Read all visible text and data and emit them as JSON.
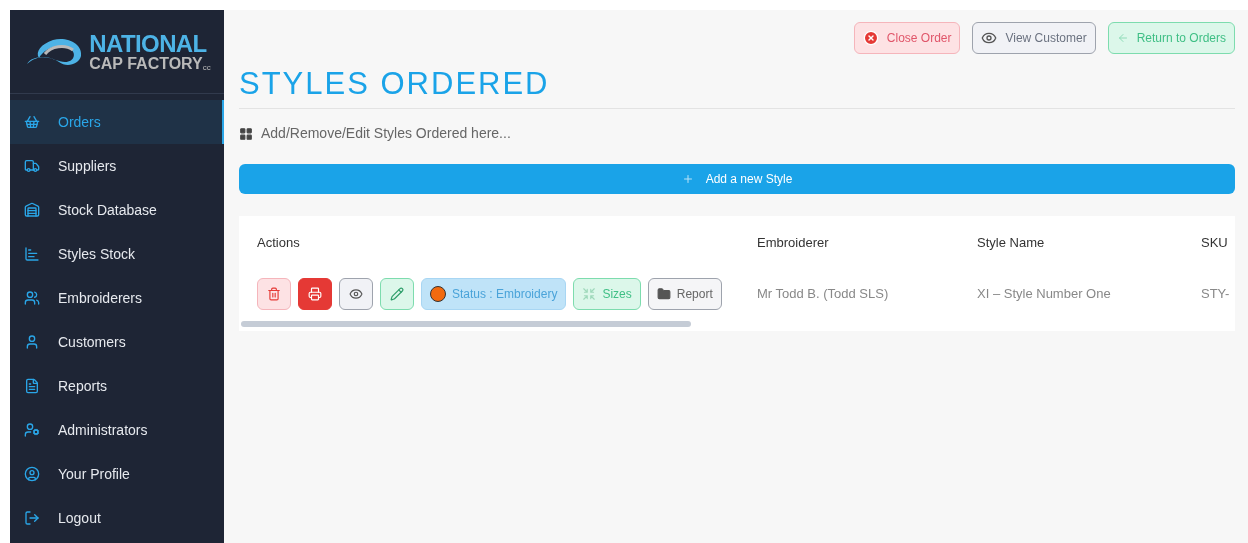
{
  "logo": {
    "line1": "NATIONAL",
    "line2": "CAP FACTORY",
    "mark": "cc"
  },
  "sidebar": {
    "items": [
      {
        "label": "Orders",
        "selected": true
      },
      {
        "label": "Suppliers",
        "selected": false
      },
      {
        "label": "Stock Database",
        "selected": false
      },
      {
        "label": "Styles Stock",
        "selected": false
      },
      {
        "label": "Embroiderers",
        "selected": false
      },
      {
        "label": "Customers",
        "selected": false
      },
      {
        "label": "Reports",
        "selected": false
      },
      {
        "label": "Administrators",
        "selected": false
      },
      {
        "label": "Your Profile",
        "selected": false
      },
      {
        "label": "Logout",
        "selected": false
      }
    ]
  },
  "header_buttons": [
    {
      "label": "Close Order",
      "kind": "danger"
    },
    {
      "label": "View Customer",
      "kind": "neutral"
    },
    {
      "label": "Return to Orders",
      "kind": "success"
    }
  ],
  "title": "STYLES ORDERED",
  "subtitle": "Add/Remove/Edit Styles Ordered here...",
  "add_button": {
    "label": "Add a new Style"
  },
  "table": {
    "columns": [
      "Actions",
      "Embroiderer",
      "Style Name",
      "SKU"
    ],
    "rows": [
      {
        "cells": [
          {
            "kind": "actions",
            "actions": [
              {
                "kind": "delete"
              },
              {
                "kind": "print"
              },
              {
                "kind": "view"
              },
              {
                "kind": "edit"
              },
              {
                "kind": "status",
                "label": "Status : Embroidery"
              },
              {
                "kind": "sizes",
                "label": "Sizes"
              },
              {
                "kind": "report",
                "label": "Report"
              }
            ]
          },
          {
            "kind": "text",
            "text": "Mr Todd B. (Todd SLS)"
          },
          {
            "kind": "text",
            "text": "XI – Style Number One"
          },
          {
            "kind": "text",
            "text": "STY-"
          }
        ]
      }
    ]
  }
}
